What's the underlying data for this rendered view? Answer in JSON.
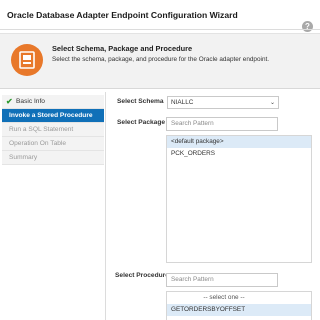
{
  "window": {
    "title": "Oracle Database Adapter Endpoint Configuration Wizard",
    "help_glyph": "?"
  },
  "header": {
    "title": "Select Schema, Package and Procedure",
    "description": "Select the schema, package, and procedure for the Oracle adapter endpoint.",
    "icon": "database-step-icon",
    "icon_color": "#e8782a"
  },
  "steps": [
    {
      "label": "Basic Info",
      "state": "completed",
      "icon": "check-icon"
    },
    {
      "label": "Invoke a Stored Procedure",
      "state": "active"
    },
    {
      "label": "Run a SQL Statement",
      "state": "disabled"
    },
    {
      "label": "Operation On Table",
      "state": "disabled"
    },
    {
      "label": "Summary",
      "state": "disabled"
    }
  ],
  "form": {
    "schema": {
      "label": "Select Schema",
      "value": "NIALLC"
    },
    "package": {
      "label": "Select Package",
      "search_placeholder": "Search Pattern",
      "options": [
        "<default package>",
        "PCK_ORDERS"
      ],
      "selected": "<default package>"
    },
    "procedure": {
      "label": "Select Procedure",
      "search_placeholder": "Search Pattern",
      "options": [
        "-- select one --",
        "GETORDERSBYOFFSET"
      ],
      "selected": "GETORDERSBYOFFSET"
    }
  },
  "colors": {
    "active_step": "#1070b8",
    "check": "#2f9a2f",
    "selected_row": "#dceaf7"
  }
}
